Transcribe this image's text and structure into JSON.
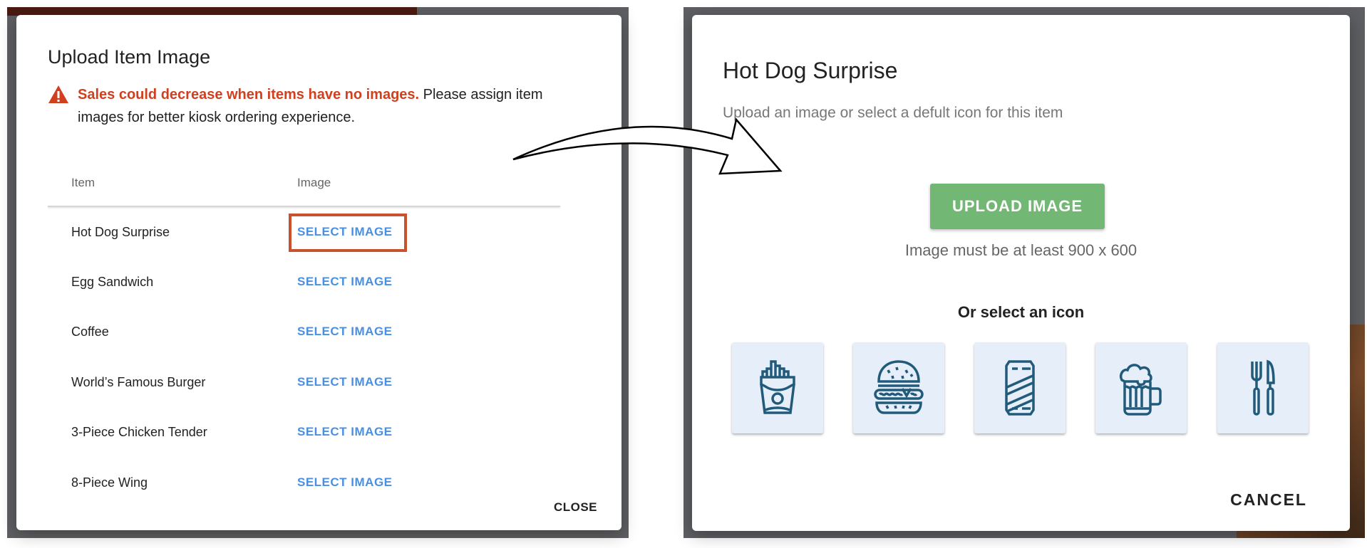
{
  "left_dialog": {
    "title": "Upload Item Image",
    "warning_bold": "Sales could decrease when items have no images.",
    "warning_text": " Please assign item images for better kiosk ordering experience.",
    "columns": [
      "Item",
      "Image"
    ],
    "rows": [
      {
        "item": "Hot Dog Surprise",
        "action": "SELECT IMAGE"
      },
      {
        "item": "Egg Sandwich",
        "action": "SELECT IMAGE"
      },
      {
        "item": "Coffee",
        "action": "SELECT IMAGE"
      },
      {
        "item": "World’s Famous Burger",
        "action": "SELECT IMAGE"
      },
      {
        "item": "3-Piece Chicken Tender",
        "action": "SELECT IMAGE"
      },
      {
        "item": "8-Piece Wing",
        "action": "SELECT IMAGE"
      }
    ],
    "close_label": "CLOSE"
  },
  "right_dialog": {
    "title": "Hot Dog Surprise",
    "subtitle": "Upload an image or select a defult icon for this item",
    "upload_label": "UPLOAD IMAGE",
    "hint": "Image must be at least 900 x 600",
    "icons_heading": "Or select an icon",
    "icons": [
      "fries-icon",
      "burger-icon",
      "soda-can-icon",
      "beer-mug-icon",
      "fork-knife-icon"
    ],
    "cancel_label": "CANCEL"
  },
  "colors": {
    "warning": "#d0401f",
    "link": "#4a90e2",
    "upload": "#72b874",
    "icon": "#215a7a",
    "icon_card": "#e6eef9",
    "highlight": "#c9522e"
  }
}
